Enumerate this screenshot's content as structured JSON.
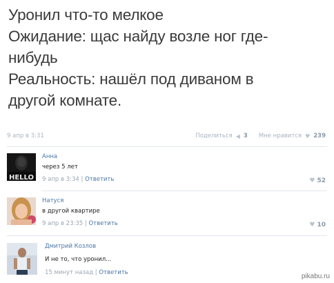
{
  "post": {
    "lines": [
      "Уронил что-то мелкое",
      "Ожидание: щас найду возле ног где-",
      "нибудь",
      "Реальность: нашёл под диваном в",
      "другой комнате."
    ],
    "date": "9 апр в 3:31",
    "share_label": "Поделиться",
    "share_count": "3",
    "like_label": "Мне нравится",
    "like_count": "239"
  },
  "comments": [
    {
      "author": "Анна",
      "text": "через 5 лет",
      "date": "9 апр в 3:34",
      "reply_label": "Ответить",
      "likes": "52",
      "avatar_text": "HELLO"
    },
    {
      "author": "Натуся",
      "text": "в другой квартире",
      "date": "9 апр в 23:35",
      "reply_label": "Ответить",
      "likes": "10"
    },
    {
      "author": "Дмитрий Козлов",
      "text": "И не то, что уронил...",
      "date": "15 минут назад",
      "reply_label": "Ответить"
    }
  ],
  "watermark": "pikabu.ru",
  "colors": {
    "link": "#4a76a8",
    "meta": "#a8b4c0",
    "divider": "#e3e7ec"
  }
}
